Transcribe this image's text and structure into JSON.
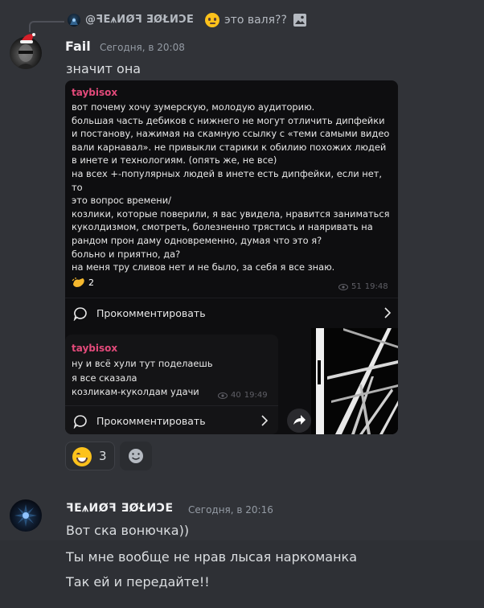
{
  "reply": {
    "author": "@ꟻE⩚ИØꟻ ƎØŁИƆE",
    "text": "это валя??",
    "emoji_icon": "thinking-face-icon",
    "attachment_icon": "image-icon"
  },
  "message1": {
    "author": "Fail",
    "timestamp": "Сегодня, в 20:08",
    "text": "значит она"
  },
  "embed": {
    "post1": {
      "author": "taybisox",
      "body": "вот почему хочу зумерскую, молодую  аудиторию.\nбольшая часть дебиков с нижнего не могут отличить дипфейки\nи постанову, нажимая  на скамную ссылку с «теми самыми видео\nвали карнавал». не привыкли старики к обилию похожих людей\nв инете и технологиям. (опять же, не все)\nна всех +-популярных людей в инете есть дипфейки, если нет, то\nэто вопрос времени/\nкозлики, которые поверили, я вас увидела, нравится заниматься\nкуколдизмом, смотреть, болезненно трястись и наяривать на\nрандом прон даму одновременно, думая что это я?\nбольно и приятно, да?\nна меня тру сливов нет и не было, за себя я все знаю.",
      "reaction_count": "2",
      "views": "51",
      "time": "19:48",
      "comment_label": "Прокомментировать"
    },
    "post2": {
      "author": "taybisox",
      "body": "ну и всё хули тут поделаешь\nя все сказала\nкозликам-куколдам удачи",
      "views": "40",
      "time": "19:49",
      "comment_label": "Прокомментировать"
    }
  },
  "reactions": {
    "grin_count": "3"
  },
  "message2": {
    "author": "ꟻE⩚ИØꟻ ƎØŁИƆE",
    "timestamp": "Сегодня, в 20:16",
    "lines": [
      "Вот ска вонючка))",
      "Ты мне вообще не нрав лысая наркоманка",
      "Так ей и передайте!!"
    ]
  },
  "colors": {
    "background": "#313338",
    "embed_bg": "#0e0e10",
    "telegram_author": "#e24a7a",
    "reaction_bg": "#2b2d31"
  }
}
